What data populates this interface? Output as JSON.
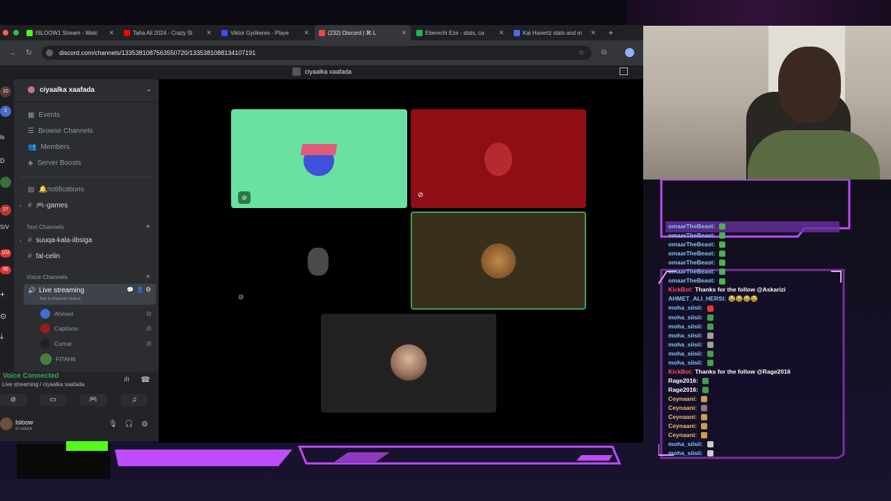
{
  "browser": {
    "tabs": [
      {
        "label": "ISLOOW1 Stream - Watc",
        "fav_color": "#53fc18"
      },
      {
        "label": "Taha Ali 2024 - Crazy Sl",
        "fav_color": "#ff0000"
      },
      {
        "label": "Viktor Gyökeres - Playe",
        "fav_color": "#3c4cff"
      },
      {
        "label": "(232) Discord | ⌘ L",
        "fav_color": "#f04747"
      },
      {
        "label": "Eberechi Eze - stats, ca",
        "fav_color": "#1db954"
      },
      {
        "label": "Kai Havertz stats and m",
        "fav_color": "#4a6cf7"
      }
    ],
    "url": "discord.com/channels/1335381087563550720/1335381088134107191"
  },
  "discord": {
    "call_title": "ciyaalka xaafada",
    "server_name": "ciyaalka xaafada",
    "nav_items": [
      {
        "label": "Events",
        "icon": "calendar-icon"
      },
      {
        "label": "Browse Channels",
        "icon": "list-icon"
      },
      {
        "label": "Members",
        "icon": "members-icon"
      },
      {
        "label": "Server Boosts",
        "icon": "boost-icon"
      }
    ],
    "channels_top": [
      {
        "label": "🔔notifications",
        "icon": "list-icon"
      },
      {
        "label": "🎮-games",
        "icon": "hash-icon"
      }
    ],
    "text_channels_header": "Text Channels",
    "text_channels": [
      "suuqa-kala-iibsiga",
      "fal-celin"
    ],
    "voice_channels_header": "Voice Channels",
    "voice_channel": {
      "label": "Live streaming",
      "status": "Set a channel status"
    },
    "members": [
      {
        "name": "Ahmed",
        "color": "#3b6fd8"
      },
      {
        "name": "Capitano",
        "color": "#9b1c1c"
      },
      {
        "name": "Cumar",
        "color": "#222222"
      },
      {
        "name": "FITAH6",
        "color": "#4f7a3a"
      }
    ],
    "voice_connected": {
      "title": "Voice Connected",
      "subtitle": "Live streaming / ciyaalka xaafada"
    },
    "user": {
      "name": "Isloow",
      "status": "In voice"
    },
    "guild_badges": [
      "10",
      "1",
      "ls",
      "D",
      "27",
      "S/V",
      "102",
      "95"
    ]
  },
  "chat": [
    {
      "user": "omaarTheBeast:",
      "msg": "",
      "emoji": "#4caf50"
    },
    {
      "user": "omaarTheBeast:",
      "msg": "",
      "emoji": "#4caf50"
    },
    {
      "user": "omaarTheBeast:",
      "msg": "",
      "emoji": "#4caf50"
    },
    {
      "user": "omaarTheBeast:",
      "msg": "",
      "emoji": "#4caf50"
    },
    {
      "user": "omaarTheBeast:",
      "msg": "",
      "emoji": "#4caf50"
    },
    {
      "user": "omaarTheBeast:",
      "msg": "",
      "emoji": "#4caf50"
    },
    {
      "user": "omaarTheBeast:",
      "msg": "",
      "emoji": "#4caf50"
    },
    {
      "user": "KickBot:",
      "msg": "Thanks for the follow @Askarizi",
      "emoji": ""
    },
    {
      "user": "AHMET_ALI_HERSI:",
      "msg": "😂😂😂😂",
      "emoji": ""
    },
    {
      "user": "moha_siisii:",
      "msg": "",
      "emoji": "#e53935"
    },
    {
      "user": "moha_siisii:",
      "msg": "",
      "emoji": "#43a047"
    },
    {
      "user": "moha_siisii:",
      "msg": "",
      "emoji": "#43a047"
    },
    {
      "user": "moha_siisii:",
      "msg": "",
      "emoji": "#9e9e9e"
    },
    {
      "user": "moha_siisii:",
      "msg": "",
      "emoji": "#9e9e9e"
    },
    {
      "user": "moha_siisii:",
      "msg": "",
      "emoji": "#43a047"
    },
    {
      "user": "moha_siisii:",
      "msg": "",
      "emoji": "#43a047"
    },
    {
      "user": "KickBot:",
      "msg": "Thanks for the follow @Rage2016",
      "emoji": ""
    },
    {
      "user": "Rage2016:",
      "msg": "",
      "emoji": "#43a047"
    },
    {
      "user": "Rage2016:",
      "msg": "",
      "emoji": "#43a047"
    },
    {
      "user": "Ceynaani:",
      "msg": "",
      "emoji": "#c9a04a"
    },
    {
      "user": "Ceynaani:",
      "msg": "",
      "emoji": "#8a7a8a"
    },
    {
      "user": "Ceynaani:",
      "msg": "",
      "emoji": "#c9a04a"
    },
    {
      "user": "Ceynaani:",
      "msg": "",
      "emoji": "#c9a04a"
    },
    {
      "user": "Ceynaani:",
      "msg": "",
      "emoji": "#c9a04a"
    },
    {
      "user": "moha_siisii:",
      "msg": "",
      "emoji": "#cccccc"
    },
    {
      "user": "moha_siisii:",
      "msg": "",
      "emoji": "#cccccc"
    }
  ],
  "colors": {
    "accent": "#c04bff",
    "kick_green": "#53fc18",
    "discord_bg": "#2b2d31"
  }
}
